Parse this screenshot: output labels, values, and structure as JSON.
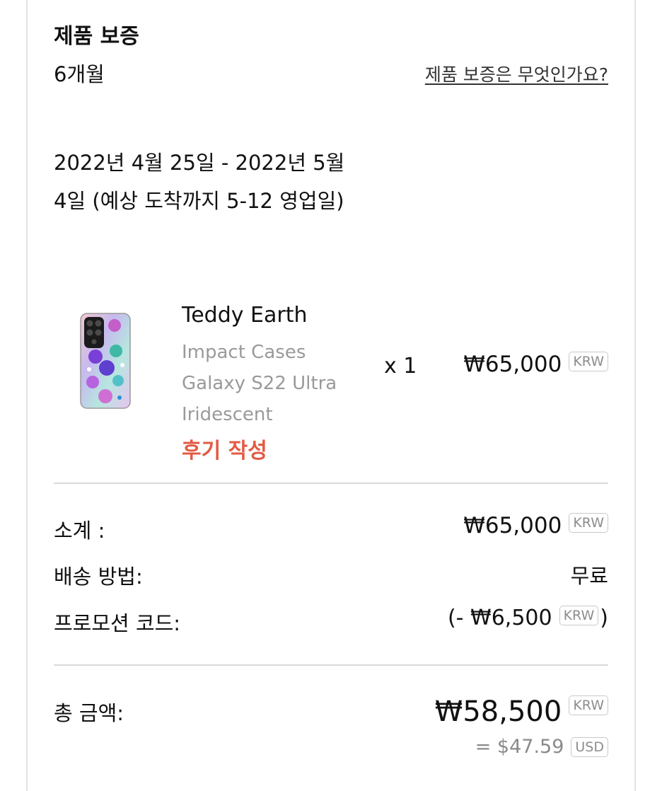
{
  "warranty": {
    "title": "제품 보증",
    "value": "6개월",
    "link": "제품 보증은 무엇인가요?"
  },
  "delivery": {
    "text": "2022년 4월 25일 - 2022년 5월 4일 (예상 도착까지 5-12 영업일)"
  },
  "product": {
    "name": "Teddy Earth",
    "desc_line1": "Impact Cases",
    "desc_line2": "Galaxy S22 Ultra",
    "desc_line3": "Iridescent",
    "review_label": "후기 작성",
    "quantity": "x 1",
    "price": "₩65,000",
    "currency": "KRW"
  },
  "summary": {
    "subtotal_label": "소계 :",
    "subtotal_value": "₩65,000",
    "subtotal_currency": "KRW",
    "shipping_label": "배송 방법:",
    "shipping_value": "무료",
    "promo_label": "프로모션 코드:",
    "promo_prefix": "(- ",
    "promo_value": "₩6,500",
    "promo_currency": "KRW",
    "promo_suffix": ")",
    "total_label": "총 금액:",
    "total_value": "₩58,500",
    "total_currency": "KRW",
    "converted_value": "= $47.59",
    "converted_currency": "USD"
  },
  "colors": {
    "accent": "#e35a43",
    "muted": "#9a9a9a",
    "divider": "#d9d9d9"
  }
}
